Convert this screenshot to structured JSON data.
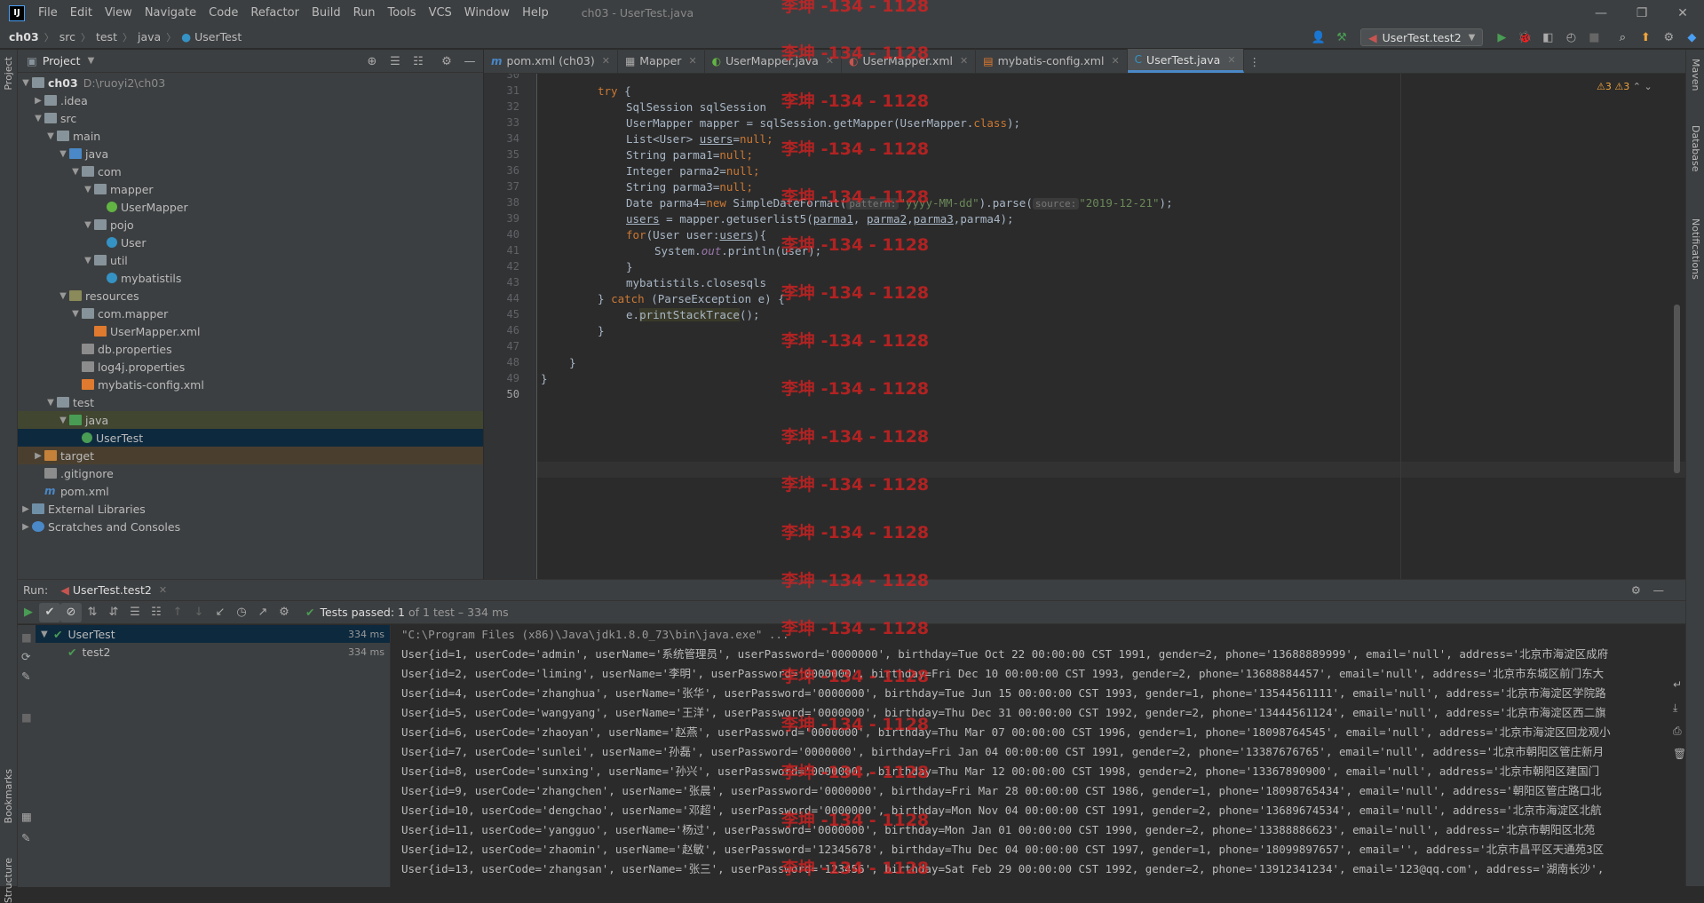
{
  "window": {
    "logo": "IJ",
    "title": "ch03 - UserTest.java",
    "menu": [
      "File",
      "Edit",
      "View",
      "Navigate",
      "Code",
      "Refactor",
      "Build",
      "Run",
      "Tools",
      "VCS",
      "Window",
      "Help"
    ]
  },
  "navbar": {
    "crumbs": [
      "ch03",
      "src",
      "test",
      "java",
      "UserTest"
    ],
    "run_config": "UserTest.test2"
  },
  "project_panel": {
    "title": "Project",
    "root": "ch03",
    "root_path": "D:\\ruoyi2\\ch03",
    "items": [
      {
        "label": "ch03",
        "hint": "D:\\ruoyi2\\ch03"
      },
      {
        "label": ".idea"
      },
      {
        "label": "src"
      },
      {
        "label": "main"
      },
      {
        "label": "java"
      },
      {
        "label": "com"
      },
      {
        "label": "mapper"
      },
      {
        "label": "UserMapper"
      },
      {
        "label": "pojo"
      },
      {
        "label": "User"
      },
      {
        "label": "util"
      },
      {
        "label": "mybatistils"
      },
      {
        "label": "resources"
      },
      {
        "label": "com.mapper"
      },
      {
        "label": "UserMapper.xml"
      },
      {
        "label": "db.properties"
      },
      {
        "label": "log4j.properties"
      },
      {
        "label": "mybatis-config.xml"
      },
      {
        "label": "test"
      },
      {
        "label": "java"
      },
      {
        "label": "UserTest"
      },
      {
        "label": "target"
      },
      {
        "label": ".gitignore"
      },
      {
        "label": "pom.xml"
      },
      {
        "label": "External Libraries"
      },
      {
        "label": "Scratches and Consoles"
      }
    ]
  },
  "editor_tabs": [
    {
      "label": "pom.xml (ch03)",
      "icon": "m"
    },
    {
      "label": "Mapper",
      "icon": "▦"
    },
    {
      "label": "UserMapper.java",
      "icon": "◐"
    },
    {
      "label": "UserMapper.xml",
      "icon": "◐"
    },
    {
      "label": "mybatis-config.xml",
      "icon": "▤"
    },
    {
      "label": "UserTest.java",
      "icon": "C"
    }
  ],
  "editor": {
    "warnings_a": "3",
    "warnings_b": "3",
    "line_numbers": [
      "30",
      "31",
      "32",
      "33",
      "34",
      "35",
      "36",
      "37",
      "38",
      "39",
      "40",
      "41",
      "42",
      "43",
      "44",
      "45",
      "46",
      "47",
      "48",
      "49",
      "50"
    ],
    "code": {
      "l31_kw": "try",
      "l31_rest": " {",
      "l32": "SqlSession sqlSession",
      "l33_a": "UserMapper mapper = sqlSession.getMapper(UserMapper.",
      "l33_kw": "class",
      "l33_b": ");",
      "l34_a": "List<User> ",
      "l34_var": "users",
      "l34_b": "=",
      "l34_kw": "null",
      "l34_c": ";",
      "l35_a": "String parma1=",
      "l35_kw": "null",
      "l35_c": ";",
      "l36_a": "Integer parma2=",
      "l36_kw": "null",
      "l36_c": ";",
      "l37_a": "String parma3=",
      "l37_kw": "null",
      "l37_c": ";",
      "l38_a": "Date parma4=",
      "l38_kw": "new",
      "l38_b": " SimpleDateFormat(",
      "l38_hint1": "pattern:",
      "l38_str1": "\"yyyy-MM-dd\"",
      "l38_c": ").parse(",
      "l38_hint2": "source:",
      "l38_str2": "\"2019-12-21\"",
      "l38_d": ");",
      "l39_var": "users",
      "l39_a": " = mapper.getuserlist5(",
      "l39_p1": "parma1",
      "l39_s1": ", ",
      "l39_p2": "parma2",
      "l39_s2": ",",
      "l39_p3": "parma3",
      "l39_b": ",parma4);",
      "l40_kw": "for",
      "l40_a": "(User user:",
      "l40_var": "users",
      "l40_b": "){",
      "l41_a": "System.",
      "l41_out": "out",
      "l41_b": ".println(user);",
      "l42": "}",
      "l43": "mybatistils.closesqls",
      "l44_a": "} ",
      "l44_kw": "catch",
      "l44_b": " (ParseException e) {",
      "l45_a": "e.",
      "l45_fn": "printStackTrace",
      "l45_b": "();",
      "l46": "}",
      "l48": "}",
      "l49": "}"
    }
  },
  "run_panel": {
    "label": "Run:",
    "tab": "UserTest.test2",
    "status_prefix": "Tests passed:",
    "status_count": "1",
    "status_suffix": "of 1 test – 334 ms",
    "tests": [
      {
        "name": "UserTest",
        "time": "334 ms"
      },
      {
        "name": "test2",
        "time": "334 ms"
      }
    ],
    "console": [
      "\"C:\\Program Files (x86)\\Java\\jdk1.8.0_73\\bin\\java.exe\" ...",
      "User{id=1, userCode='admin', userName='系统管理员', userPassword='0000000', birthday=Tue Oct 22 00:00:00 CST 1991, gender=2, phone='13688889999', email='null', address='北京市海淀区成府",
      "User{id=2, userCode='liming', userName='李明', userPassword='0000000', birthday=Fri Dec 10 00:00:00 CST 1993, gender=2, phone='13688884457', email='null', address='北京市东城区前门东大",
      "User{id=4, userCode='zhanghua', userName='张华', userPassword='0000000', birthday=Tue Jun 15 00:00:00 CST 1993, gender=1, phone='13544561111', email='null', address='北京市海淀区学院路",
      "User{id=5, userCode='wangyang', userName='王洋', userPassword='0000000', birthday=Thu Dec 31 00:00:00 CST 1992, gender=2, phone='13444561124', email='null', address='北京市海淀区西二旗",
      "User{id=6, userCode='zhaoyan', userName='赵燕', userPassword='0000000', birthday=Thu Mar 07 00:00:00 CST 1996, gender=1, phone='18098764545', email='null', address='北京市海淀区回龙观小",
      "User{id=7, userCode='sunlei', userName='孙磊', userPassword='0000000', birthday=Fri Jan 04 00:00:00 CST 1991, gender=2, phone='13387676765', email='null', address='北京市朝阳区管庄新月",
      "User{id=8, userCode='sunxing', userName='孙兴', userPassword='0000000', birthday=Thu Mar 12 00:00:00 CST 1998, gender=2, phone='13367890900', email='null', address='北京市朝阳区建国门",
      "User{id=9, userCode='zhangchen', userName='张晨', userPassword='0000000', birthday=Fri Mar 28 00:00:00 CST 1986, gender=1, phone='18098765434', email='null', address='朝阳区管庄路口北",
      "User{id=10, userCode='dengchao', userName='邓超', userPassword='0000000', birthday=Mon Nov 04 00:00:00 CST 1991, gender=2, phone='13689674534', email='null', address='北京市海淀区北航",
      "User{id=11, userCode='yangguo', userName='杨过', userPassword='0000000', birthday=Mon Jan 01 00:00:00 CST 1990, gender=2, phone='13388886623', email='null', address='北京市朝阳区北苑",
      "User{id=12, userCode='zhaomin', userName='赵敏', userPassword='12345678', birthday=Thu Dec 04 00:00:00 CST 1997, gender=1, phone='18099897657', email='', address='北京市昌平区天通苑3区",
      "User{id=13, userCode='zhangsan', userName='张三', userPassword='123456', birthday=Sat Feb 29 00:00:00 CST 1992, gender=2, phone='13912341234', email='123@qq.com', address='湖南长沙',"
    ]
  },
  "side_strips": {
    "left": [
      "Project",
      "Bookmarks",
      "Structure"
    ],
    "right": [
      "Maven",
      "Database",
      "Notifications"
    ]
  },
  "watermark": "李坤 -134 - 1128"
}
